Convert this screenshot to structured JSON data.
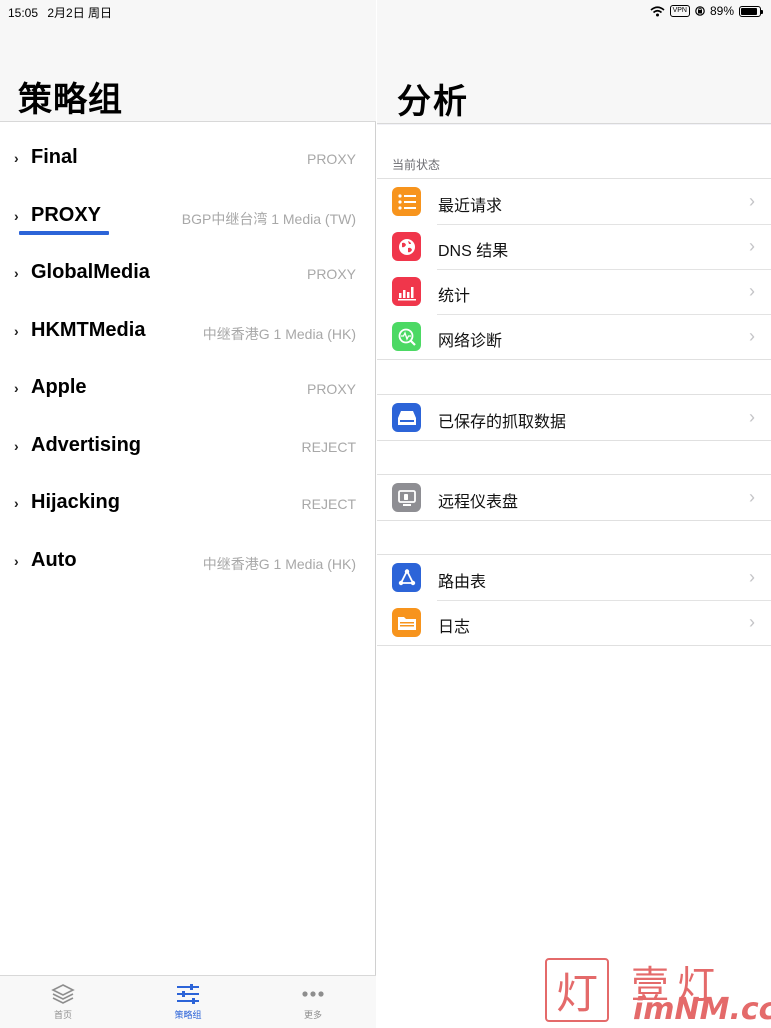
{
  "status_bar": {
    "time": "15:05",
    "date": "2月2日 周日",
    "vpn": "VPN",
    "battery": "89%",
    "battery_level": 0.89
  },
  "left": {
    "title": "策略组",
    "policies": [
      {
        "name": "Final",
        "value": "PROXY"
      },
      {
        "name": "PROXY",
        "value": "BGP中继台湾 1 Media (TW)"
      },
      {
        "name": "GlobalMedia",
        "value": "PROXY"
      },
      {
        "name": "HKMTMedia",
        "value": "中继香港G 1 Media (HK)"
      },
      {
        "name": "Apple",
        "value": "PROXY"
      },
      {
        "name": "Advertising",
        "value": "REJECT"
      },
      {
        "name": "Hijacking",
        "value": "REJECT"
      },
      {
        "name": "Auto",
        "value": "中继香港G 1 Media (HK)"
      }
    ],
    "tabs": [
      {
        "label": "首页",
        "icon": "layers-icon"
      },
      {
        "label": "策略组",
        "icon": "sliders-icon"
      },
      {
        "label": "更多",
        "icon": "more-icon"
      }
    ]
  },
  "right": {
    "title": "分析",
    "section_label": "当前状态",
    "group1": [
      {
        "label": "最近请求",
        "icon": "list-icon",
        "color": "#f7941d"
      },
      {
        "label": "DNS 结果",
        "icon": "globe-icon",
        "color": "#f0364b"
      },
      {
        "label": "统计",
        "icon": "bar-chart-icon",
        "color": "#f0364b"
      },
      {
        "label": "网络诊断",
        "icon": "diagnose-icon",
        "color": "#4cd964"
      }
    ],
    "group2": [
      {
        "label": "已保存的抓取数据",
        "icon": "drive-icon",
        "color": "#2c64d8"
      }
    ],
    "group3": [
      {
        "label": "远程仪表盘",
        "icon": "dashboard-icon",
        "color": "#8e8e93"
      }
    ],
    "group4": [
      {
        "label": "路由表",
        "icon": "route-icon",
        "color": "#2c64d8"
      },
      {
        "label": "日志",
        "icon": "folder-icon",
        "color": "#f7941d"
      }
    ]
  },
  "watermark": {
    "char": "灯",
    "cn": "壹灯",
    "url": "imNM.cc"
  }
}
